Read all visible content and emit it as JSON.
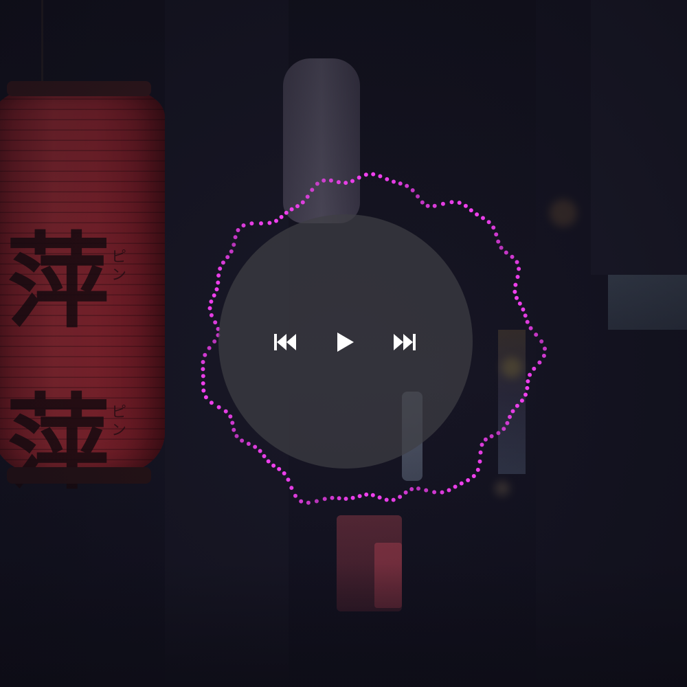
{
  "background": {
    "lantern_left_glyph_top": "萍",
    "lantern_left_glyph_bottom": "萍",
    "lantern_left_kana_top": "ピン",
    "lantern_left_kana_bottom": "ピン"
  },
  "player": {
    "state": "paused",
    "visualizer_color": "#f040ee",
    "disc_color": "#3e3e44",
    "icon_color": "#ffffff",
    "controls": [
      {
        "name": "previous",
        "icon": "skip-previous-icon"
      },
      {
        "name": "play",
        "icon": "play-icon"
      },
      {
        "name": "next",
        "icon": "skip-next-icon"
      }
    ]
  }
}
